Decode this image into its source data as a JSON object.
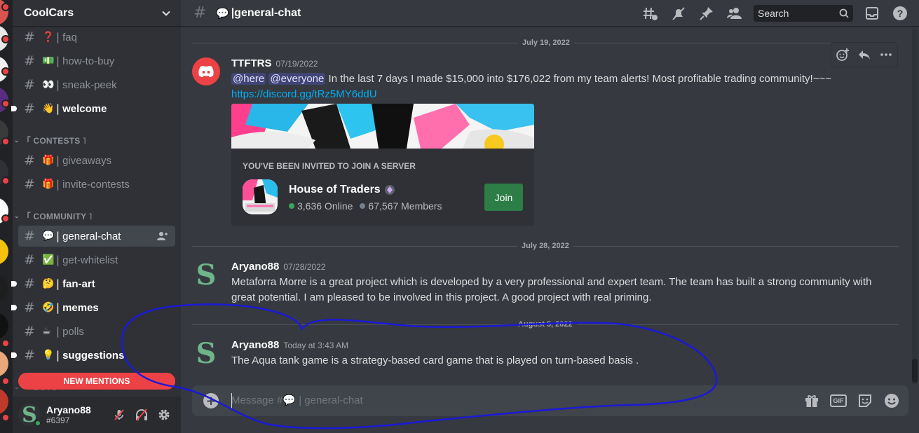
{
  "guild": {
    "name": "CoolCars"
  },
  "channels": [
    {
      "emoji": "❓",
      "name": "faq",
      "unread": false
    },
    {
      "emoji": "💵",
      "name": "how-to-buy",
      "unread": false
    },
    {
      "emoji": "👀",
      "name": "sneak-peek",
      "unread": false
    },
    {
      "emoji": "👋",
      "name": "welcome",
      "unread": true
    },
    {
      "emoji": "🎁",
      "name": "giveaways",
      "unread": false
    },
    {
      "emoji": "🎁",
      "name": "invite-contests",
      "unread": false
    },
    {
      "emoji": "💬",
      "name": "general-chat",
      "unread": false,
      "active": true
    },
    {
      "emoji": "✅",
      "name": "get-whitelist",
      "unread": false
    },
    {
      "emoji": "🤔",
      "name": "fan-art",
      "unread": true
    },
    {
      "emoji": "🤣",
      "name": "memes",
      "unread": true
    },
    {
      "emoji": "☕",
      "name": "polls",
      "unread": false
    },
    {
      "emoji": "💡",
      "name": "suggestions",
      "unread": true
    }
  ],
  "categories": {
    "contests": "「 CONTESTS ˥",
    "community": "「 COMMUNITY ˥",
    "bots": "「 BOTS ˥"
  },
  "new_mentions": "NEW MENTIONS",
  "user": {
    "name": "Aryano88",
    "tag": "#6397"
  },
  "topbar": {
    "channel_emoji": "💬",
    "channel_name": "general-chat",
    "search_placeholder": "Search"
  },
  "dates": {
    "d1": "July 19, 2022",
    "d2": "July 28, 2022",
    "d3": "August 5, 2022"
  },
  "messages": [
    {
      "author": "TTFTRS",
      "time": "07/19/2022",
      "mention_here": "@here",
      "mention_everyone": "@everyone",
      "text": "In the last 7 days I made $15,000 into $176,022 from my team alerts! Most profitable trading community!~~~",
      "link": "https://discord.gg/tRz5MY6ddU"
    },
    {
      "author": "Aryano88",
      "time": "07/28/2022",
      "text_line1": "Metaforra Morre is a great project which is developed by a very professional and expert team. The team has built a strong community with",
      "text_line2": "great potential. I am pleased to be involved in this project. A good project with real priming."
    },
    {
      "author": "Aryano88",
      "time": "Today at 3:43 AM",
      "text": "The Aqua tank game is a strategy-based card game that is played on turn-based basis ."
    }
  ],
  "invite": {
    "heading": "YOU'VE BEEN INVITED TO JOIN A SERVER",
    "server_name": "House of Traders",
    "online": "3,636 Online",
    "members": "67,567 Members",
    "join_label": "Join"
  },
  "composer": {
    "placeholder_prefix": "Message #",
    "placeholder_emoji": "💬",
    "placeholder_channel": "general-chat",
    "gif_label": "GIF"
  },
  "colors": {
    "accent": "#5865f2",
    "danger": "#ed4245",
    "online": "#3ba55d",
    "join": "#2d7d46",
    "annotation_stroke": "#1a1ad6"
  }
}
